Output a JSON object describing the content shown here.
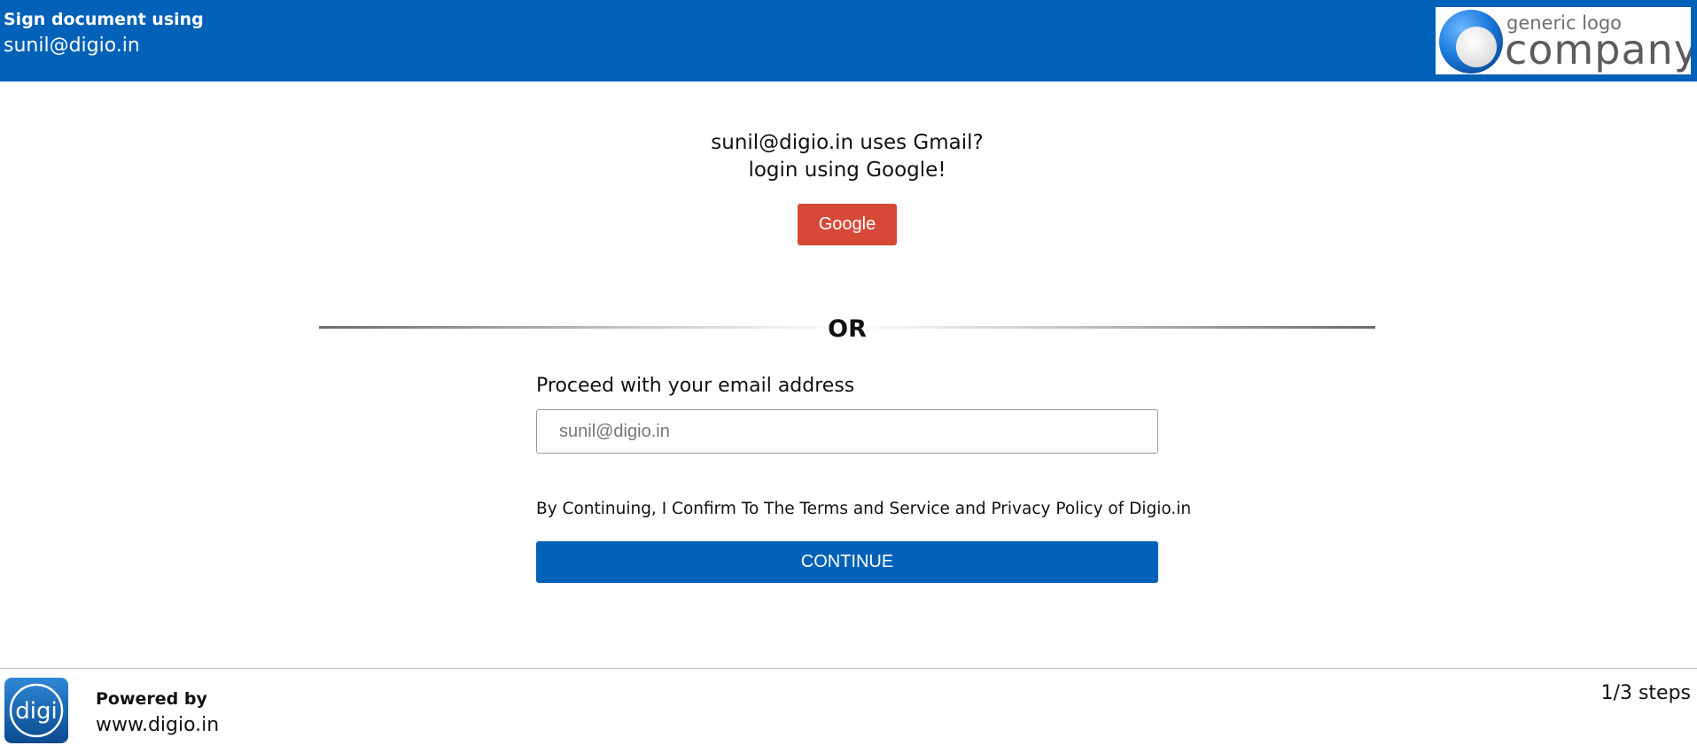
{
  "header": {
    "title": "Sign document using",
    "email": "sunil@digio.in",
    "background_color": "#0061b8",
    "logo": {
      "line1": "generic logo",
      "line2": "company",
      "icon": "blue-circle-logo-icon"
    }
  },
  "google_section": {
    "question": "sunil@digio.in uses Gmail?",
    "prompt": "login using Google!",
    "button_label": "Google",
    "button_color": "#d64937"
  },
  "divider": {
    "label": "OR"
  },
  "email_form": {
    "label": "Proceed with your email address",
    "input_value": "",
    "input_placeholder": "sunil@digio.in",
    "terms_text": "By Continuing, I Confirm To The Terms and Service and Privacy Policy of Digio.in",
    "continue_label": "CONTINUE",
    "continue_color": "#0061b8"
  },
  "footer": {
    "logo_text": "digi",
    "logo_icon": "digio-logo-icon",
    "powered_by": "Powered by",
    "url": "www.digio.in",
    "steps": "1/3 steps"
  }
}
